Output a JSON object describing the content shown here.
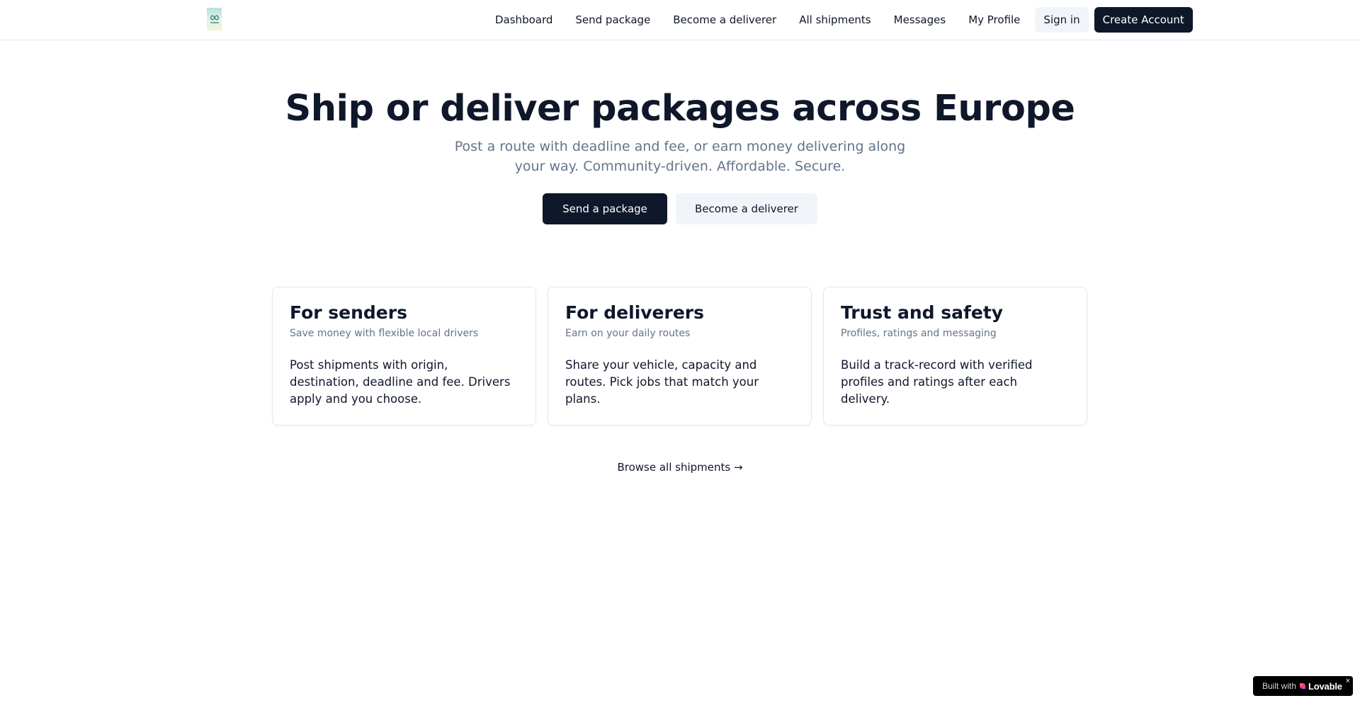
{
  "header": {
    "logo_icon": "brand-logo-icon",
    "nav": [
      {
        "label": "Dashboard"
      },
      {
        "label": "Send package"
      },
      {
        "label": "Become a deliverer"
      },
      {
        "label": "All shipments"
      },
      {
        "label": "Messages"
      },
      {
        "label": "My Profile"
      }
    ],
    "sign_in_label": "Sign in",
    "create_account_label": "Create Account"
  },
  "hero": {
    "title": "Ship or deliver packages across Europe",
    "subtitle": "Post a route with deadline and fee, or earn money delivering along your way. Community-driven. Affordable. Secure.",
    "primary_cta": "Send a package",
    "secondary_cta": "Become a deliverer"
  },
  "features": [
    {
      "title": "For senders",
      "subtitle": "Save money with flexible local drivers",
      "body": "Post shipments with origin, destination, deadline and fee. Drivers apply and you choose."
    },
    {
      "title": "For deliverers",
      "subtitle": "Earn on your daily routes",
      "body": "Share your vehicle, capacity and routes. Pick jobs that match your plans."
    },
    {
      "title": "Trust and safety",
      "subtitle": "Profiles, ratings and messaging",
      "body": "Build a track-record with verified profiles and ratings after each delivery."
    }
  ],
  "browse_link": "Browse all shipments →",
  "badge": {
    "prefix": "Built with",
    "brand": "Lovable",
    "close": "×",
    "heart_icon": "lovable-heart-icon"
  },
  "colors": {
    "primary": "#0f172a",
    "muted_text": "#64748b",
    "secondary_bg": "#f1f5f9",
    "border": "#e2e8f0"
  }
}
